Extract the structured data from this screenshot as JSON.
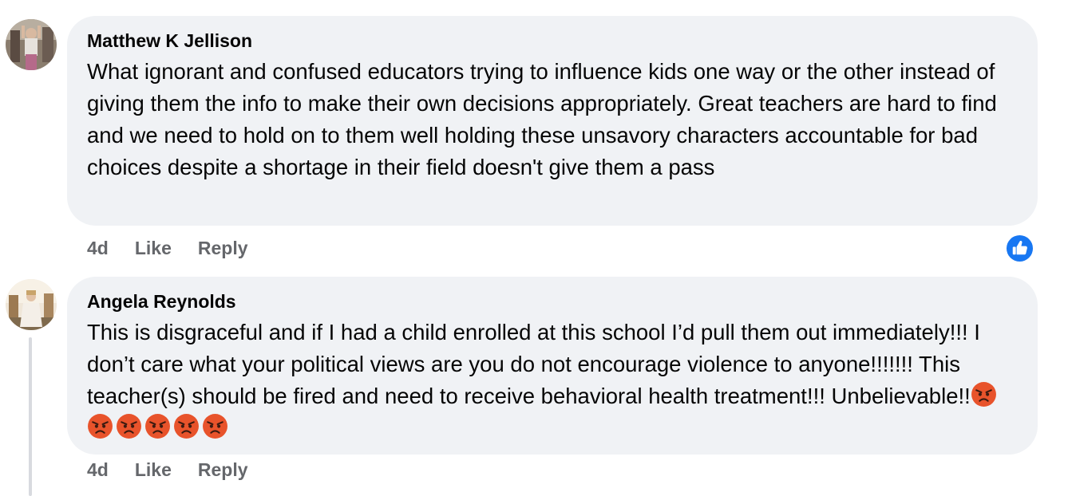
{
  "comments": [
    {
      "author": "Matthew K Jellison",
      "text": "What ignorant and confused educators trying to influence kids one way or the other instead of giving them the info to make their own decisions appropriately. Great teachers are hard to find and we need to hold on to them well holding these unsavory characters accountable for bad choices despite a shortage in their field doesn't give them a pass",
      "time": "4d",
      "like_label": "Like",
      "reply_label": "Reply"
    },
    {
      "author": "Angela Reynolds",
      "text": "This is disgraceful and if I had a child enrolled at this school I’d pull them out immediately!!! I don’t care what your political views are you do not encourage violence to anyone!!!!!!! This teacher(s) should be fired and need to receive behavioral health treatment!!! Unbelievable!!",
      "emoji": [
        "angry-face",
        "angry-face",
        "angry-face",
        "angry-face",
        "angry-face",
        "angry-face"
      ],
      "time": "4d",
      "like_label": "Like",
      "reply_label": "Reply"
    }
  ],
  "reaction_badge": {
    "icon": "thumbs-up-icon",
    "color": "#1877f2"
  },
  "colors": {
    "bubble": "#f0f2f5",
    "secondary_text": "#65676b",
    "thread_line": "#d8dadf",
    "angry_emoji": "#e8532b"
  }
}
